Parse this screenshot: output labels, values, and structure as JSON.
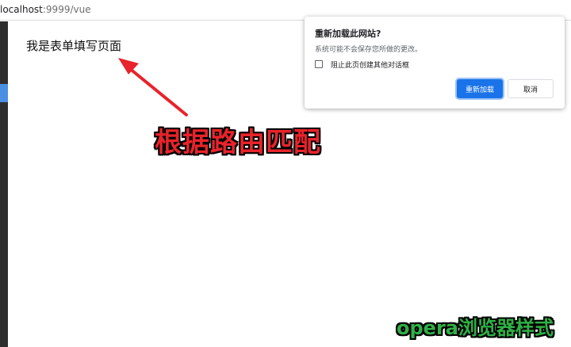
{
  "browser": {
    "url_host": "localhost",
    "url_rest": ":9999/vue"
  },
  "page": {
    "heading": "我是表单填写页面"
  },
  "annotations": {
    "main_label": "根据路由匹配",
    "corner_label": "opera浏览器样式",
    "main_color": "#e8232b",
    "corner_color": "#2fb045"
  },
  "dialog": {
    "title": "重新加载此网站?",
    "message": "系统可能不会保存您所做的更改。",
    "checkbox_label": "阻止此页创建其他对话框",
    "checkbox_checked": false,
    "reload_button": "重新加载",
    "cancel_button": "取消",
    "accent_color": "#1a73e8"
  }
}
